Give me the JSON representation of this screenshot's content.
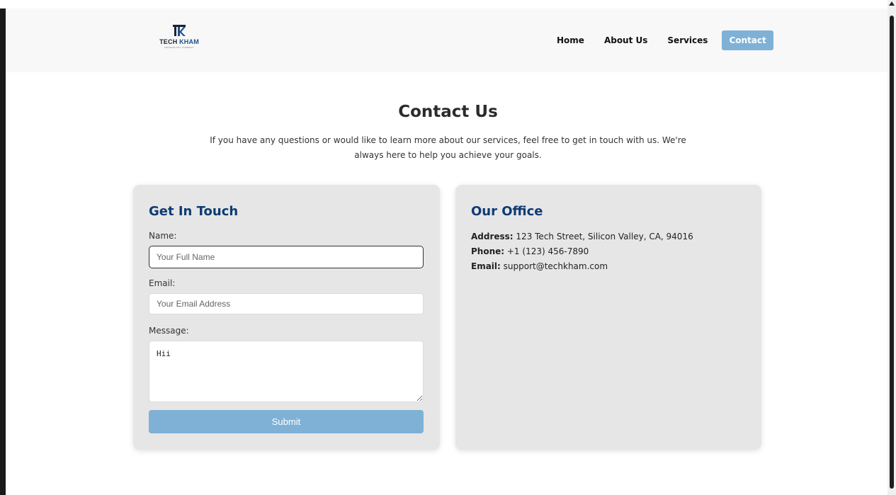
{
  "brand": {
    "name_part1": "TECH ",
    "name_part2": "KHAM",
    "tagline": "TECHNOLOGY COMPANY"
  },
  "nav": {
    "items": [
      {
        "label": "Home"
      },
      {
        "label": "About Us"
      },
      {
        "label": "Services"
      },
      {
        "label": "Contact"
      }
    ],
    "active": "Contact"
  },
  "page": {
    "title": "Contact Us",
    "intro": "If you have any questions or would like to learn more about our services, feel free to get in touch with us. We're always here to help you achieve your goals."
  },
  "form": {
    "heading": "Get In Touch",
    "name_label": "Name:",
    "name_placeholder": "Your Full Name",
    "name_value": "",
    "email_label": "Email:",
    "email_placeholder": "Your Email Address",
    "email_value": "",
    "message_label": "Message:",
    "message_value": "Hii",
    "submit_label": "Submit"
  },
  "office": {
    "heading": "Our Office",
    "address_label": "Address:",
    "address_value": " 123 Tech Street, Silicon Valley, CA, 94016",
    "phone_label": "Phone:",
    "phone_value": " +1 (123) 456-7890",
    "email_label": "Email:",
    "email_value": " support@techkham.com"
  },
  "colors": {
    "accent": "#7fb1d6",
    "heading_blue": "#0d3b73",
    "card_bg": "#e6e6e6",
    "navbar_bg": "#f8f8f8"
  },
  "icons": {
    "logo": "tk-logo-icon",
    "scroll_up": "scroll-up-arrow-icon"
  }
}
